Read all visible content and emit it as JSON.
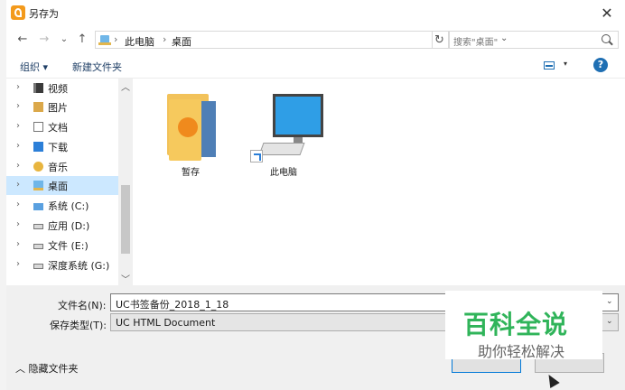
{
  "window": {
    "title": "另存为",
    "close_icon": "✕"
  },
  "nav": {
    "back": "←",
    "forward": "→",
    "history": "⌄",
    "up": "↑"
  },
  "address": {
    "crumbs": [
      "此电脑",
      "桌面"
    ],
    "separator": "›",
    "dropdown": "⌄",
    "refresh": "↻"
  },
  "search": {
    "placeholder": "搜索\"桌面\""
  },
  "toolbar": {
    "organize": "组织 ▾",
    "new_folder": "新建文件夹",
    "view_dropdown": "▾",
    "help": "?"
  },
  "sidebar": {
    "items": [
      {
        "label": "视频",
        "icon": "video-icon",
        "selected": false
      },
      {
        "label": "图片",
        "icon": "pictures-icon",
        "selected": false
      },
      {
        "label": "文档",
        "icon": "documents-icon",
        "selected": false
      },
      {
        "label": "下载",
        "icon": "downloads-icon",
        "selected": false
      },
      {
        "label": "音乐",
        "icon": "music-icon",
        "selected": false
      },
      {
        "label": "桌面",
        "icon": "desktop-icon",
        "selected": true
      },
      {
        "label": "系统 (C:)",
        "icon": "system-drive-icon",
        "selected": false
      },
      {
        "label": "应用 (D:)",
        "icon": "drive-icon",
        "selected": false
      },
      {
        "label": "文件 (E:)",
        "icon": "drive-icon",
        "selected": false
      },
      {
        "label": "深度系统 (G:)",
        "icon": "drive-icon",
        "selected": false
      }
    ],
    "chevron": "›",
    "scroll_up": "︿",
    "scroll_down": "﹀"
  },
  "content": {
    "items": [
      {
        "label": "暂存",
        "icon": "folder-icon"
      },
      {
        "label": "此电脑",
        "icon": "computer-icon"
      }
    ]
  },
  "form": {
    "filename_label": "文件名(N):",
    "filename_value": "UC书签备份_2018_1_18",
    "filetype_label": "保存类型(T):",
    "filetype_value": "UC HTML Document",
    "dropdown_arrow": "⌄"
  },
  "footer": {
    "hide_folders": "隐藏文件夹",
    "hide_chevron": "︿"
  },
  "watermark": {
    "main": "百科全说",
    "sub": "助你轻松解决"
  }
}
